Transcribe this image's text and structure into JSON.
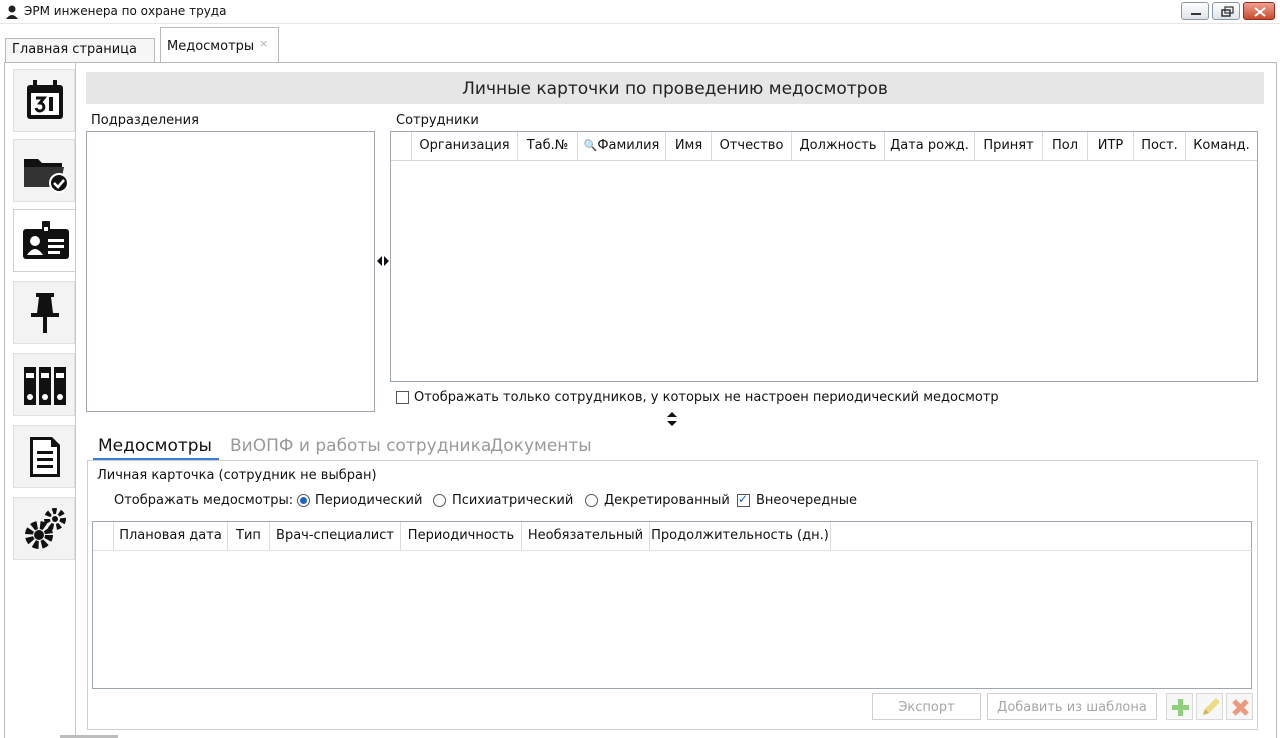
{
  "window": {
    "title": "ЭРМ инженера по охране труда"
  },
  "tabs": [
    {
      "label": "Главная страница"
    },
    {
      "label": "Медосмотры",
      "close": "×"
    }
  ],
  "header": {
    "title": "Личные карточки по проведению медосмотров"
  },
  "departments": {
    "label": "Подразделения"
  },
  "employees": {
    "label": "Сотрудники",
    "columns": [
      "Организация",
      "Таб.№",
      "Фамилия",
      "Имя",
      "Отчество",
      "Должность",
      "Дата рожд.",
      "Принят",
      "Пол",
      "ИТР",
      "Пост.",
      "Команд."
    ],
    "filter_label": "Отображать только сотрудников, у которых не настроен периодический медосмотр"
  },
  "inner_tabs": [
    "Медосмотры",
    "ВиОПФ и работы сотрудника",
    "Документы"
  ],
  "card": {
    "title": "Личная карточка (сотрудник не выбран)",
    "show_label": "Отображать медосмотры:",
    "options": [
      {
        "label": "Периодический",
        "checked": true
      },
      {
        "label": "Психиатрический",
        "checked": false
      },
      {
        "label": "Декретированный",
        "checked": false
      },
      {
        "label": "Внеочередные",
        "checked": true
      }
    ],
    "columns": [
      "Плановая дата",
      "Тип",
      "Врач-специалист",
      "Периодичность",
      "Необязательный",
      "Продолжительность (дн.)"
    ]
  },
  "buttons": {
    "export": "Экспорт",
    "add_template": "Добавить из шаблона"
  },
  "colors": {
    "add": "#7cc36b",
    "edit": "#e8d46a",
    "delete": "#e58a6a",
    "accent": "#3a7bd5"
  }
}
